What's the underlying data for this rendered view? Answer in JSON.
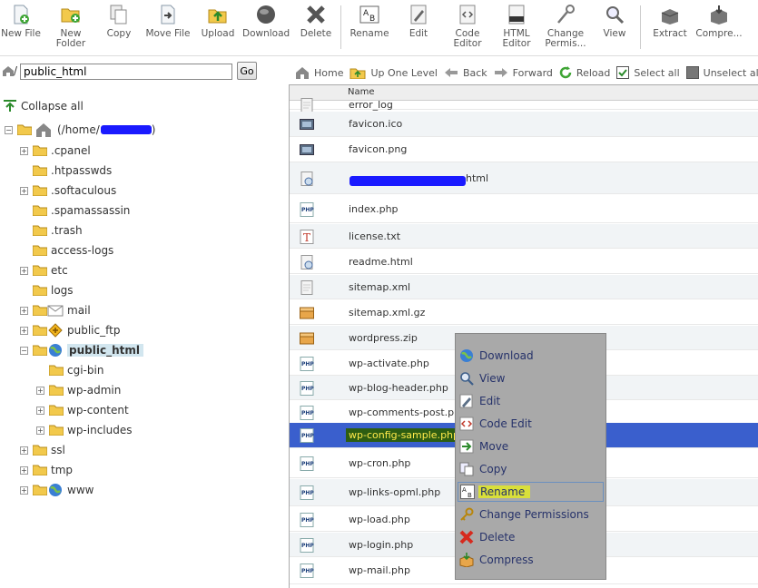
{
  "toolbar": {
    "buttons": [
      {
        "label": "New File",
        "icon": "new-file-icon"
      },
      {
        "label": "New\nFolder",
        "icon": "new-folder-icon"
      },
      {
        "label": "Copy",
        "icon": "copy-icon"
      },
      {
        "label": "Move File",
        "icon": "move-file-icon"
      },
      {
        "label": "Upload",
        "icon": "upload-icon"
      },
      {
        "label": "Download",
        "icon": "download-icon"
      },
      {
        "label": "Delete",
        "icon": "delete-icon"
      },
      {
        "label": "Rename",
        "icon": "rename-icon"
      },
      {
        "label": "Edit",
        "icon": "edit-icon"
      },
      {
        "label": "Code\nEditor",
        "icon": "code-editor-icon"
      },
      {
        "label": "HTML\nEditor",
        "icon": "html-editor-icon"
      },
      {
        "label": "Change\nPermis...",
        "icon": "change-permissions-icon"
      },
      {
        "label": "View",
        "icon": "view-icon"
      },
      {
        "label": "Extract",
        "icon": "extract-icon"
      },
      {
        "label": "Compre...",
        "icon": "compress-icon"
      }
    ]
  },
  "pathbar": {
    "prefix": "/",
    "value": "public_html",
    "go_label": "Go"
  },
  "tree": {
    "collapse_label": "Collapse all",
    "root_label": "(/home/",
    "root_suffix": ")",
    "nodes": [
      {
        "label": ".cpanel",
        "expandable": true
      },
      {
        "label": ".htpasswds",
        "expandable": false
      },
      {
        "label": ".softaculous",
        "expandable": true
      },
      {
        "label": ".spamassassin",
        "expandable": false
      },
      {
        "label": ".trash",
        "expandable": false
      },
      {
        "label": "access-logs",
        "expandable": false
      },
      {
        "label": "etc",
        "expandable": true
      },
      {
        "label": "logs",
        "expandable": false
      },
      {
        "label": "mail",
        "expandable": true
      },
      {
        "label": "public_ftp",
        "expandable": true
      },
      {
        "label": "public_html",
        "expandable": true,
        "expanded": true
      },
      {
        "label": "cgi-bin",
        "expandable": false
      },
      {
        "label": "wp-admin",
        "expandable": true
      },
      {
        "label": "wp-content",
        "expandable": true
      },
      {
        "label": "wp-includes",
        "expandable": true
      },
      {
        "label": "ssl",
        "expandable": true
      },
      {
        "label": "tmp",
        "expandable": true
      },
      {
        "label": "www",
        "expandable": true
      }
    ]
  },
  "nav": {
    "home": "Home",
    "up": "Up One Level",
    "back": "Back",
    "forward": "Forward",
    "reload": "Reload",
    "select_all": "Select all",
    "unselect_all": "Unselect all"
  },
  "filelist": {
    "column_name": "Name",
    "files": [
      {
        "name": "error_log",
        "icon": "text-file-icon"
      },
      {
        "name": "favicon.ico",
        "icon": "image-file-icon"
      },
      {
        "name": "favicon.png",
        "icon": "image-file-icon"
      },
      {
        "name": "html",
        "icon": "html-file-icon"
      },
      {
        "name": "index.php",
        "icon": "php-file-icon"
      },
      {
        "name": "license.txt",
        "icon": "txt-file-icon"
      },
      {
        "name": "readme.html",
        "icon": "html-file-icon"
      },
      {
        "name": "sitemap.xml",
        "icon": "text-file-icon"
      },
      {
        "name": "sitemap.xml.gz",
        "icon": "archive-file-icon"
      },
      {
        "name": "wordpress.zip",
        "icon": "archive-file-icon"
      },
      {
        "name": "wp-activate.php",
        "icon": "php-file-icon"
      },
      {
        "name": "wp-blog-header.php",
        "icon": "php-file-icon"
      },
      {
        "name": "wp-comments-post.php",
        "icon": "php-file-icon"
      },
      {
        "name": "wp-config-sample.php",
        "icon": "php-file-icon",
        "selected": true
      },
      {
        "name": "wp-cron.php",
        "icon": "php-file-icon"
      },
      {
        "name": "wp-links-opml.php",
        "icon": "php-file-icon"
      },
      {
        "name": "wp-load.php",
        "icon": "php-file-icon"
      },
      {
        "name": "wp-login.php",
        "icon": "php-file-icon"
      },
      {
        "name": "wp-mail.php",
        "icon": "php-file-icon"
      }
    ]
  },
  "context_menu": {
    "items": [
      {
        "label": "Download",
        "icon": "download-globe-icon"
      },
      {
        "label": "View",
        "icon": "magnifier-icon"
      },
      {
        "label": "Edit",
        "icon": "edit-pencil-icon"
      },
      {
        "label": "Code Edit",
        "icon": "code-edit-icon"
      },
      {
        "label": "Move",
        "icon": "move-arrow-icon"
      },
      {
        "label": "Copy",
        "icon": "copy-pages-icon"
      },
      {
        "label": "Rename",
        "icon": "rename-ab-icon",
        "highlighted": true
      },
      {
        "label": "Change Permissions",
        "icon": "key-icon"
      },
      {
        "label": "Delete",
        "icon": "red-x-icon"
      },
      {
        "label": "Compress",
        "icon": "compress-box-icon"
      }
    ]
  },
  "colors": {
    "selected_row": "#3a5fcd",
    "selected_name_bg": "#2d5d12",
    "selected_name_fg": "#ffe94a",
    "menu_bg": "#a9a9a9",
    "menu_text": "#26326a",
    "rename_highlight": "#d9df3a",
    "redaction": "#1a1aff"
  }
}
